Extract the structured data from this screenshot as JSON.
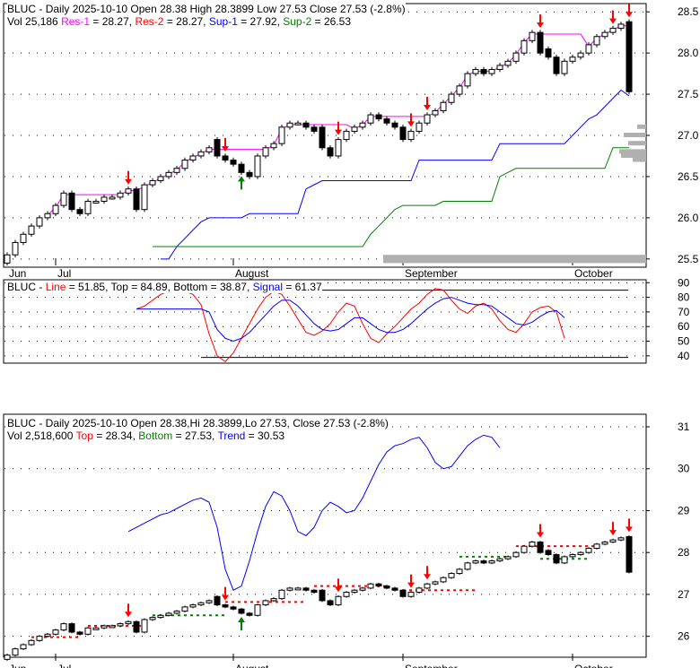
{
  "panel1": {
    "line1": {
      "symbol": "BLUC",
      "sep": " - ",
      "rest": "Daily 2025-10-10 Open 28.38  High 28.3899  Low 27.53  Close 27.53 (-2.8%)"
    },
    "line2": {
      "vol": "Vol 25,186 ",
      "res1_label": "Res-1",
      "res1_val": " = 28.27, ",
      "res2_label": "Res-2",
      "res2_val": " = 28.27, ",
      "sup1_label": "Sup-1",
      "sup1_val": " = 27.92, ",
      "sup2_label": "Sup-2",
      "sup2_val": " = 26.53"
    }
  },
  "panel2": {
    "prefix": "BLUC - ",
    "line_label": "Line",
    "line_val": " = 51.85, Top = 84.89, Bottom = 38.87, ",
    "signal_label": "Signal",
    "signal_val": " = 61.37"
  },
  "panel3": {
    "line1": "BLUC - Daily 2025-10-10 Open 28.38,Hi 28.3899,Lo 27.53, Close 27.53 (-2.8%)",
    "line2": {
      "vol": "Vol 2,518,600 ",
      "top_label": "Top",
      "top_val": " = 28.34, ",
      "bottom_label": "Bottom",
      "bottom_val": " = 27.53, ",
      "trend_label": "Trend",
      "trend_val": " = 30.53"
    }
  },
  "colors": {
    "up_arrow": "#008000",
    "down_arrow": "#ff0000",
    "res1": "#ff00ff",
    "sup1": "#0000ff",
    "sup2": "#008000",
    "line": "#ff0000",
    "signal": "#0000ff",
    "trend": "#0000ff",
    "profile": "#b0b0b0"
  },
  "chart_data": [
    {
      "type": "candlestick",
      "title": "BLUC - Daily",
      "ylim": [
        25.4,
        28.6
      ],
      "yticks": [
        "25.5",
        "26.0",
        "26.5",
        "27.0",
        "27.5",
        "28.0",
        "28.5"
      ],
      "month_labels": [
        {
          "label": "Jun",
          "index": 0
        },
        {
          "label": "Jul",
          "index": 6
        },
        {
          "label": "August",
          "index": 28
        },
        {
          "label": "September",
          "index": 49
        },
        {
          "label": "October",
          "index": 70
        }
      ],
      "close": [
        25.55,
        25.7,
        25.8,
        25.9,
        26.0,
        26.05,
        26.15,
        26.3,
        26.1,
        26.05,
        26.2,
        26.2,
        26.25,
        26.25,
        26.3,
        26.35,
        26.1,
        26.4,
        26.45,
        26.5,
        26.55,
        26.6,
        26.7,
        26.75,
        26.8,
        26.85,
        26.75,
        26.7,
        26.65,
        26.55,
        26.5,
        26.75,
        26.85,
        26.9,
        27.1,
        27.15,
        27.15,
        27.1,
        27.05,
        26.85,
        26.75,
        26.95,
        27.05,
        27.1,
        27.15,
        27.25,
        27.2,
        27.15,
        27.1,
        26.95,
        27.05,
        27.15,
        27.25,
        27.3,
        27.4,
        27.5,
        27.6,
        27.75,
        27.8,
        27.75,
        27.8,
        27.85,
        27.9,
        28.0,
        28.15,
        28.25,
        28.0,
        27.95,
        27.75,
        27.9,
        27.95,
        28.0,
        28.1,
        28.2,
        28.25,
        28.3,
        28.35,
        27.53
      ],
      "open": [
        25.45,
        25.55,
        25.7,
        25.8,
        25.9,
        26.0,
        26.05,
        26.15,
        26.3,
        26.1,
        26.05,
        26.2,
        26.2,
        26.25,
        26.25,
        26.3,
        26.35,
        26.1,
        26.4,
        26.45,
        26.5,
        26.55,
        26.6,
        26.7,
        26.75,
        26.8,
        26.95,
        26.75,
        26.7,
        26.65,
        26.55,
        26.5,
        26.75,
        26.85,
        26.9,
        27.1,
        27.15,
        27.15,
        27.1,
        27.1,
        26.85,
        26.75,
        26.95,
        27.05,
        27.1,
        27.15,
        27.25,
        27.2,
        27.15,
        27.1,
        26.95,
        27.05,
        27.15,
        27.25,
        27.3,
        27.4,
        27.5,
        27.6,
        27.75,
        27.8,
        27.75,
        27.8,
        27.85,
        27.9,
        28.0,
        28.15,
        28.25,
        28.05,
        27.95,
        27.75,
        27.9,
        27.95,
        28.0,
        28.1,
        28.2,
        28.25,
        28.3,
        28.38
      ],
      "down_arrows": [
        15,
        27,
        41,
        50,
        52,
        66,
        75,
        77
      ],
      "up_arrows": [
        29
      ]
    },
    {
      "type": "line",
      "ylim": [
        35,
        92
      ],
      "yticks": [
        "40",
        "50",
        "60",
        "70",
        "80",
        "90"
      ],
      "start_index": 16,
      "series": [
        {
          "name": "Line",
          "values": [
            72,
            74,
            78,
            82,
            84,
            85,
            84,
            82,
            75,
            55,
            40,
            36,
            42,
            52,
            62,
            72,
            80,
            84,
            82,
            74,
            65,
            56,
            54,
            57,
            62,
            70,
            76,
            74,
            62,
            52,
            49,
            55,
            60,
            66,
            72,
            76,
            82,
            86,
            85,
            78,
            72,
            69,
            74,
            76,
            72,
            64,
            58,
            56,
            62,
            70,
            73,
            74,
            70,
            52
          ]
        },
        {
          "name": "Signal",
          "values": [
            72,
            72,
            72,
            72,
            72,
            72,
            72,
            72,
            72,
            70,
            58,
            52,
            50,
            52,
            56,
            62,
            68,
            74,
            78,
            78,
            74,
            68,
            62,
            58,
            57,
            58,
            62,
            66,
            66,
            62,
            58,
            56,
            56,
            58,
            62,
            67,
            72,
            76,
            79,
            80,
            78,
            76,
            75,
            75,
            74,
            70,
            66,
            62,
            61,
            63,
            67,
            70,
            71,
            66
          ]
        }
      ],
      "top_line": 84.89,
      "bottom_line": 38.87
    },
    {
      "type": "candlestick+line",
      "ylim": [
        25.5,
        31.3
      ],
      "yticks": [
        "26",
        "27",
        "28",
        "29",
        "30",
        "31"
      ],
      "trend": {
        "start_index": 15,
        "values": [
          28.5,
          28.6,
          28.7,
          28.8,
          28.9,
          28.95,
          29.05,
          29.15,
          29.25,
          29.3,
          29.2,
          28.6,
          27.6,
          27.1,
          27.2,
          27.8,
          28.5,
          29.1,
          29.45,
          29.35,
          29.0,
          28.5,
          28.4,
          28.6,
          29.0,
          29.2,
          29.1,
          28.95,
          29.0,
          29.3,
          29.7,
          30.1,
          30.4,
          30.55,
          30.6,
          30.7,
          30.75,
          30.5,
          30.15,
          30.0,
          30.05,
          30.3,
          30.55,
          30.7,
          30.8,
          30.75,
          30.5
        ]
      },
      "top_segments": [
        {
          "from": 3,
          "to": 9,
          "value": 25.98
        },
        {
          "from": 10,
          "to": 17,
          "value": 26.25
        },
        {
          "from": 27,
          "to": 37,
          "value": 26.82
        },
        {
          "from": 38,
          "to": 47,
          "value": 27.2
        },
        {
          "from": 49,
          "to": 58,
          "value": 27.1
        },
        {
          "from": 63,
          "to": 73,
          "value": 28.15
        }
      ],
      "bottom_segments": [
        {
          "from": 18,
          "to": 27,
          "value": 26.5
        },
        {
          "from": 56,
          "to": 62,
          "value": 27.9
        },
        {
          "from": 66,
          "to": 72,
          "value": 27.85
        }
      ]
    }
  ]
}
